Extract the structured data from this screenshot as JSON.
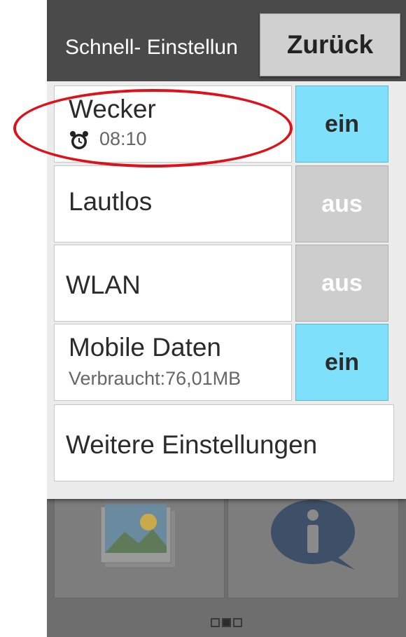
{
  "header": {
    "title": "Schnell- Einstellun",
    "back_label": "Zurück"
  },
  "settings": [
    {
      "label": "Wecker",
      "sub": "08:10",
      "sub_icon": "alarm-clock-icon",
      "state": "ein",
      "on": true
    },
    {
      "label": "Lautlos",
      "sub": "",
      "state": "aus",
      "on": false
    },
    {
      "label": "WLAN",
      "sub": "",
      "state": "aus",
      "on": false
    },
    {
      "label": "Mobile Daten",
      "sub": "Verbraucht:76,01MB",
      "state": "ein",
      "on": true
    }
  ],
  "more_settings_label": "Weitere Einstellungen",
  "home_tiles": [
    {
      "icon": "gallery-icon"
    },
    {
      "icon": "info-icon"
    }
  ],
  "pager": {
    "count": 3,
    "active_index": 1
  },
  "colors": {
    "toggle_on": "#7ee0fa",
    "toggle_off": "#cdcdcd",
    "header": "#4a4a4a",
    "annotation": "#e0101a"
  }
}
